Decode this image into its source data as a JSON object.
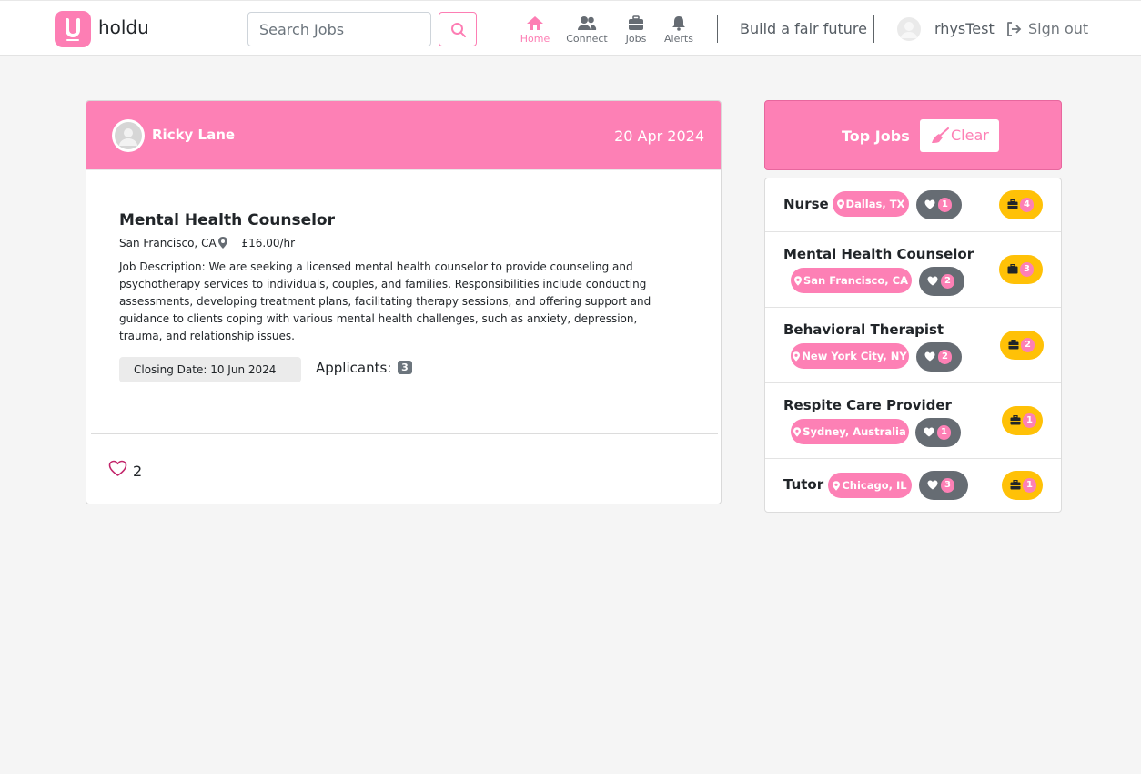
{
  "colors": {
    "accent": "#fd80b5",
    "warning": "#ffc107",
    "muted": "#666c73"
  },
  "header": {
    "brand": "holdu",
    "search": {
      "placeholder": "Search Jobs",
      "value": ""
    },
    "nav": [
      {
        "label": "Home",
        "icon": "home-icon",
        "active": true
      },
      {
        "label": "Connect",
        "icon": "users-icon",
        "active": false
      },
      {
        "label": "Jobs",
        "icon": "briefcase-icon",
        "active": false
      },
      {
        "label": "Alerts",
        "icon": "bell-icon",
        "active": false
      }
    ],
    "tagline": "Build a fair future",
    "username": "rhysTest",
    "signout": "Sign out"
  },
  "post": {
    "author": "Ricky Lane",
    "date": "20 Apr 2024",
    "job_title": "Mental Health Counselor",
    "location": "San Francisco, CA",
    "rate": "£16.00/hr",
    "description": "Job Description: We are seeking a licensed mental health counselor to provide counseling and psychotherapy services to individuals, couples, and families. Responsibilities include conducting assessments, developing treatment plans, facilitating therapy sessions, and offering support and guidance to clients coping with various mental health challenges, such as anxiety, depression, trauma, and relationship issues.",
    "closing_date": "Closing Date: 10 Jun 2024",
    "applicants_label": "Applicants:",
    "applicants_count": "3",
    "likes": "2"
  },
  "top_jobs": {
    "title": "Top Jobs",
    "clear_label": "Clear",
    "items": [
      {
        "name": "Nurse",
        "location": "Dallas, TX",
        "likes": "1",
        "applicants": "4"
      },
      {
        "name": "Mental Health Counselor",
        "location": "San Francisco, CA",
        "likes": "2",
        "applicants": "3"
      },
      {
        "name": "Behavioral Therapist",
        "location": "New York City, NY",
        "likes": "2",
        "applicants": "2"
      },
      {
        "name": "Respite Care Provider",
        "location": "Sydney, Australia",
        "likes": "1",
        "applicants": "1"
      },
      {
        "name": "Tutor",
        "location": "Chicago, IL",
        "likes": "3",
        "applicants": "1"
      }
    ]
  }
}
